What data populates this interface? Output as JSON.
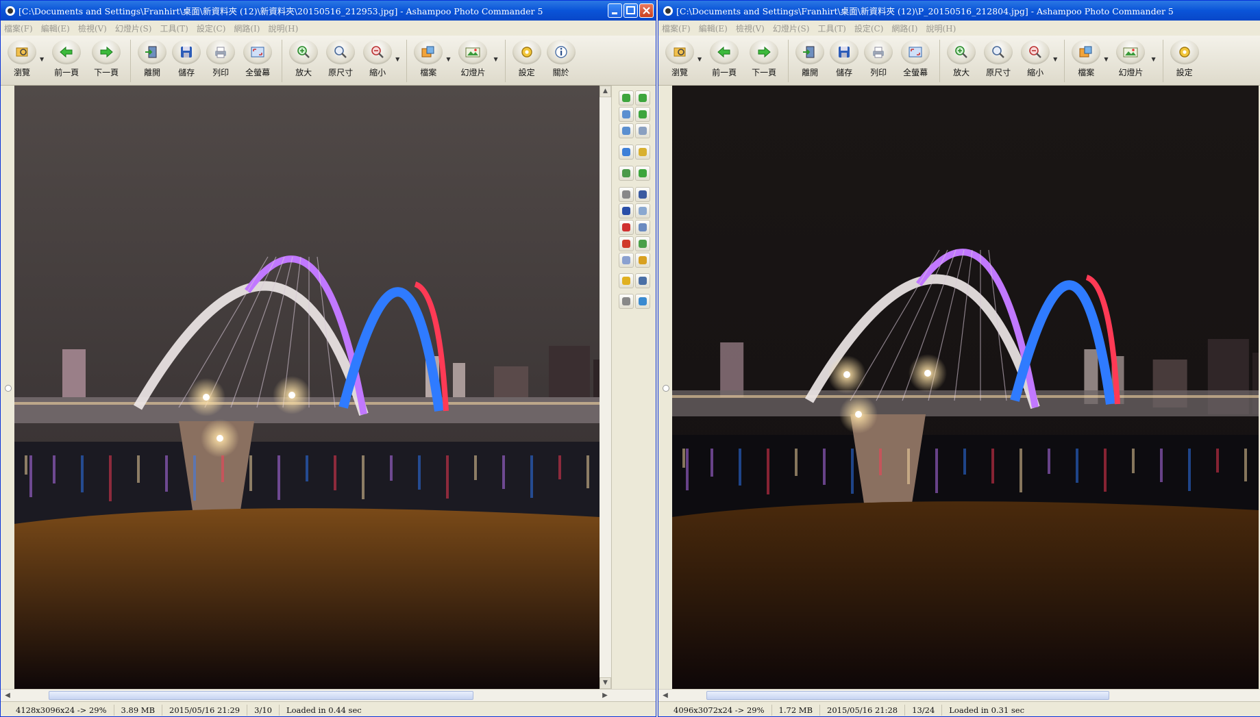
{
  "colors": {
    "titlebar": "#0A54D8",
    "chrome": "#ECE9D8",
    "sky_left": "#4A4443",
    "sky_right": "#161312",
    "bridge_white": "#EDE6E6",
    "bridge_purple": "#C178FF",
    "bridge_blue": "#2F7BFF",
    "bridge_red": "#FF3A55",
    "lamp": "#FFE3A8"
  },
  "left": {
    "title": "[C:\\Documents and Settings\\Franhirt\\桌面\\新資料夾 (12)\\新資料夾\\20150516_212953.jpg] - Ashampoo Photo Commander 5",
    "menu": [
      "檔案(F)",
      "編輯(E)",
      "檢視(V)",
      "幻燈片(S)",
      "工具(T)",
      "設定(C)",
      "網路(I)",
      "說明(H)"
    ],
    "toolbar": [
      {
        "label": "瀏覽",
        "icon": "browse-icon"
      },
      {
        "label": "前一頁",
        "icon": "previous-arrow-icon"
      },
      {
        "label": "下一頁",
        "icon": "next-arrow-icon"
      },
      {
        "label": "離開",
        "icon": "exit-door-icon"
      },
      {
        "label": "儲存",
        "icon": "floppy-disk-icon"
      },
      {
        "label": "列印",
        "icon": "printer-icon"
      },
      {
        "label": "全螢幕",
        "icon": "fullscreen-icon"
      },
      {
        "label": "放大",
        "icon": "zoom-in-icon"
      },
      {
        "label": "原尺寸",
        "icon": "actual-size-icon"
      },
      {
        "label": "縮小",
        "icon": "zoom-out-icon"
      },
      {
        "label": "檔案",
        "icon": "file-manager-icon"
      },
      {
        "label": "幻燈片",
        "icon": "slideshow-icon"
      },
      {
        "label": "設定",
        "icon": "settings-gear-icon"
      },
      {
        "label": "關於",
        "icon": "info-icon"
      }
    ],
    "status": {
      "dimensions": "4128x3096x24 -> 29%",
      "size": "3.89 MB",
      "date": "2015/05/16 21:29",
      "position": "3/10",
      "load": "Loaded in 0.44 sec"
    }
  },
  "right": {
    "title": "[C:\\Documents and Settings\\Franhirt\\桌面\\新資料夾 (12)\\P_20150516_212804.jpg] - Ashampoo Photo Commander 5",
    "menu": [
      "檔案(F)",
      "編輯(E)",
      "檢視(V)",
      "幻燈片(S)",
      "工具(T)",
      "設定(C)",
      "網路(I)",
      "說明(H)"
    ],
    "toolbar": [
      {
        "label": "瀏覽",
        "icon": "browse-icon"
      },
      {
        "label": "前一頁",
        "icon": "previous-arrow-icon"
      },
      {
        "label": "下一頁",
        "icon": "next-arrow-icon"
      },
      {
        "label": "離開",
        "icon": "exit-door-icon"
      },
      {
        "label": "儲存",
        "icon": "floppy-disk-icon"
      },
      {
        "label": "列印",
        "icon": "printer-icon"
      },
      {
        "label": "全螢幕",
        "icon": "fullscreen-icon"
      },
      {
        "label": "放大",
        "icon": "zoom-in-icon"
      },
      {
        "label": "原尺寸",
        "icon": "actual-size-icon"
      },
      {
        "label": "縮小",
        "icon": "zoom-out-icon"
      },
      {
        "label": "檔案",
        "icon": "file-manager-icon"
      },
      {
        "label": "幻燈片",
        "icon": "slideshow-icon"
      },
      {
        "label": "設定",
        "icon": "settings-gear-icon"
      }
    ],
    "status": {
      "dimensions": "4096x3072x24 -> 29%",
      "size": "1.72 MB",
      "date": "2015/05/16 21:28",
      "position": "13/24",
      "load": "Loaded in 0.31 sec"
    }
  },
  "edit_panel_icons": [
    "rotate-left-icon",
    "flip-vertical-icon",
    "rotate-90-icon",
    "flip-horizontal-icon",
    "rotate-180-icon",
    "rotate-right-icon",
    "color-adjust-icon",
    "image-properties-icon",
    "resize-icon",
    "crop-icon",
    "clone-stamp-icon",
    "select-frame-icon",
    "text-tool-icon",
    "speech-bubble-icon",
    "red-eye-icon",
    "rectangle-icon",
    "arrow-pointer-icon",
    "pencil-icon",
    "eraser-icon",
    "effects-icon",
    "bookmark-icon",
    "info-icon",
    "magic-wand-icon",
    "color-palette-icon"
  ]
}
